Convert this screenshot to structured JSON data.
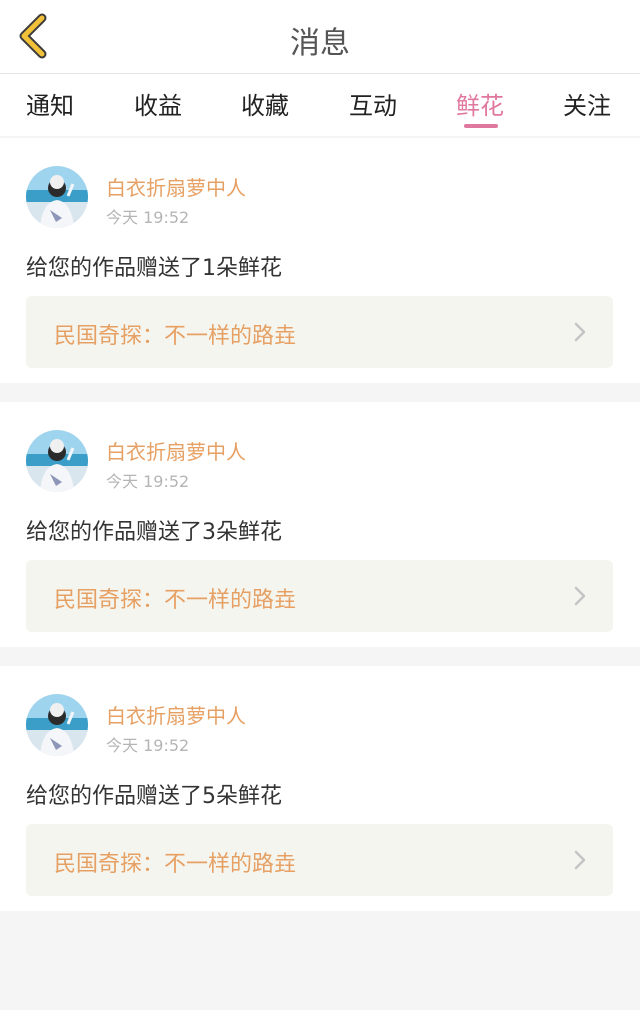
{
  "header": {
    "title": "消息"
  },
  "tabs": [
    {
      "label": "通知"
    },
    {
      "label": "收益"
    },
    {
      "label": "收藏"
    },
    {
      "label": "互动"
    },
    {
      "label": "鲜花",
      "active": true
    },
    {
      "label": "关注"
    }
  ],
  "colors": {
    "accent": "#e0779e",
    "username": "#e6a063",
    "work_box_bg": "#f5f5ef"
  },
  "messages": [
    {
      "user": "白衣折扇萝中人",
      "time": "今天 19:52",
      "text": "给您的作品赠送了1朵鲜花",
      "work": "民国奇探：不一样的路垚"
    },
    {
      "user": "白衣折扇萝中人",
      "time": "今天 19:52",
      "text": "给您的作品赠送了3朵鲜花",
      "work": "民国奇探：不一样的路垚"
    },
    {
      "user": "白衣折扇萝中人",
      "time": "今天 19:52",
      "text": "给您的作品赠送了5朵鲜花",
      "work": "民国奇探：不一样的路垚"
    }
  ]
}
